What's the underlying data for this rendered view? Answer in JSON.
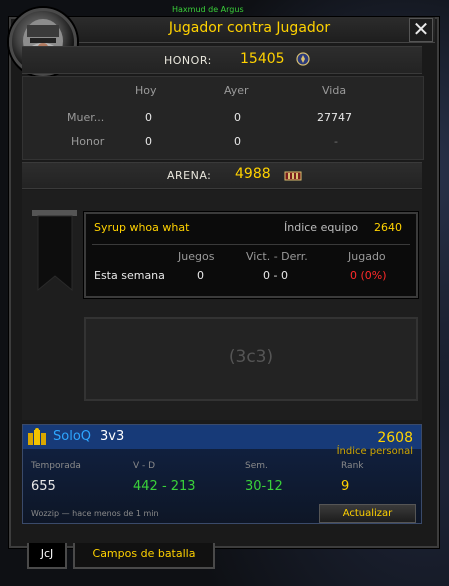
{
  "window": {
    "title": "Jugador contra Jugador",
    "top_caption": "Haxmud de Argus",
    "close_icon": "close-icon"
  },
  "honor": {
    "label": "HONOR:",
    "value": "15405",
    "icon": "alliance-crest-icon"
  },
  "stats": {
    "columns": [
      "Hoy",
      "Ayer",
      "Vida"
    ],
    "rows": [
      {
        "label": "Muer...",
        "values": [
          "0",
          "0",
          "27747"
        ]
      },
      {
        "label": "Honor",
        "values": [
          "0",
          "0",
          "-"
        ]
      }
    ]
  },
  "arena": {
    "label": "ARENA:",
    "value": "4988",
    "icon": "arena-points-icon"
  },
  "team": {
    "name": "Syrup whoa what",
    "rating_label": "Índice equipo",
    "rating": "2640",
    "headers": [
      "Juegos",
      "Vict. - Derr.",
      "Jugado"
    ],
    "row_label": "Esta semana",
    "games": "0",
    "win_loss": "0 - 0",
    "played": "0 (0%)",
    "banner_icon": "team-banner-icon"
  },
  "empty_slot": {
    "label": "(3c3)"
  },
  "soloq": {
    "name": "SoloQ",
    "bracket": "3v3",
    "rating": "2608",
    "rating_label": "Índice personal",
    "icon": "soloq-players-icon",
    "labels": [
      "Temporada",
      "V - D",
      "Sem.",
      "Rank"
    ],
    "values": [
      "655",
      "442 - 213",
      "30-12",
      "9"
    ],
    "footer": "Wozzip  —  hace menos de 1 min",
    "update_button": "Actualizar"
  },
  "tabs": [
    {
      "label": "JcJ",
      "active": true
    },
    {
      "label": "Campos de batalla",
      "active": false
    }
  ],
  "colors": {
    "gold": "#ffd200",
    "green": "#3ad13a",
    "red": "#ff2a2a",
    "blue": "#2ea6ff"
  }
}
